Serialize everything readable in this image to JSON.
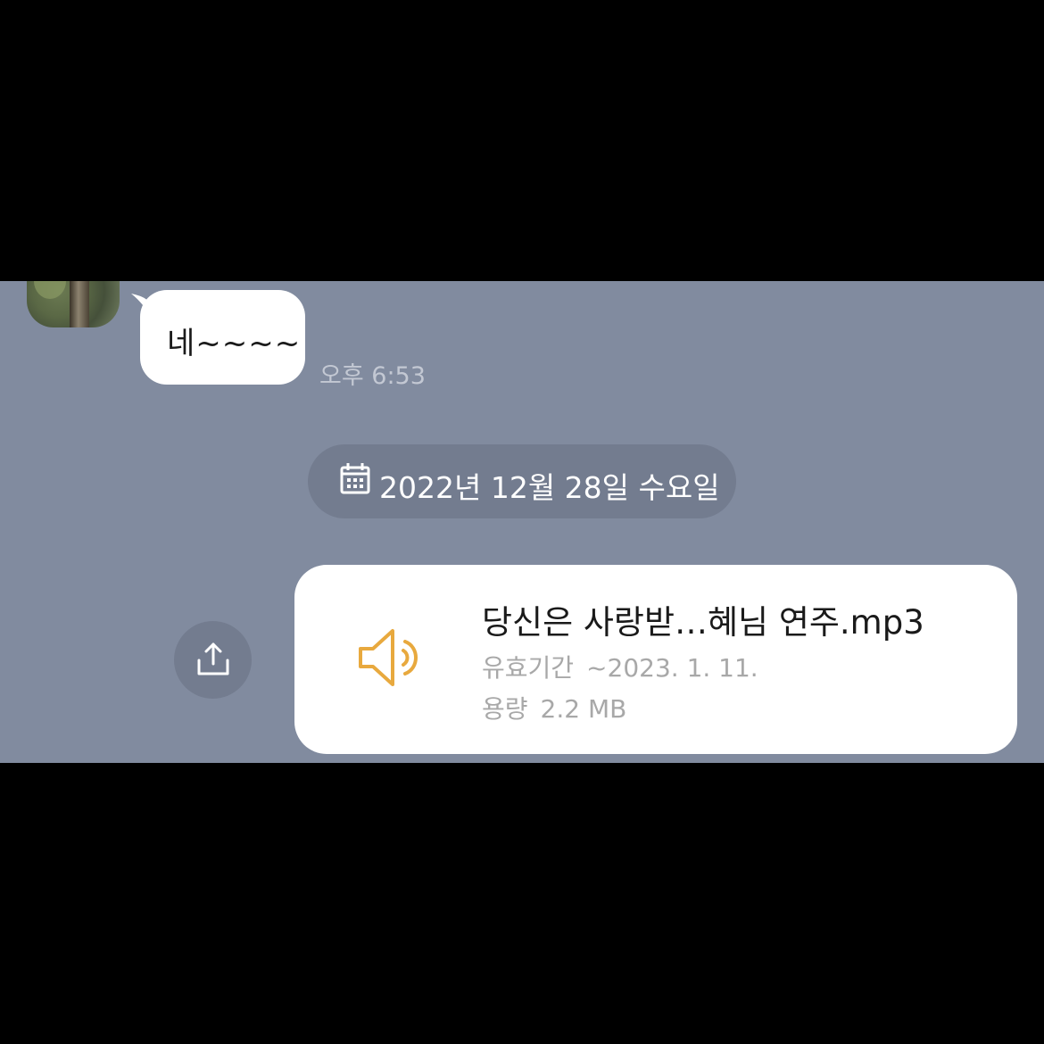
{
  "incoming": {
    "message": "네~~~~",
    "time": "오후 6:53"
  },
  "date_divider": {
    "label": "2022년 12월 28일 수요일",
    "icon": "calendar-icon"
  },
  "file_message": {
    "file_name": "당신은 사랑받…혜님 연주.mp3",
    "expiry_label": "유효기간",
    "expiry_value": "~2023. 1. 11.",
    "size_label": "용량",
    "size_value": "2.2 MB",
    "icon": "speaker-icon",
    "icon_color": "#e8a93e"
  },
  "share_button": {
    "icon": "share-icon"
  },
  "colors": {
    "chat_background": "#818b9f",
    "pill_background": "#737c8f",
    "bubble": "#ffffff"
  }
}
